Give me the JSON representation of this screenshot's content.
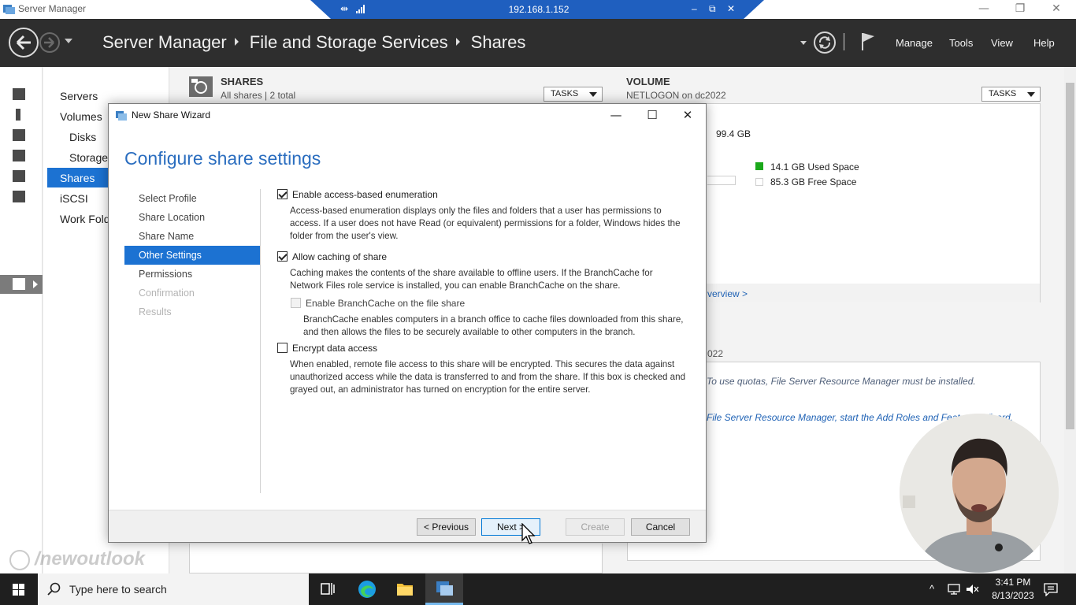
{
  "window": {
    "title": "Server Manager",
    "minimize": "—",
    "maximize": "❐",
    "close": "✕"
  },
  "rdp": {
    "address": "192.168.1.152",
    "minimize": "–",
    "restore": "⧉",
    "close": "✕"
  },
  "header": {
    "breadcrumb": [
      "Server Manager",
      "File and Storage Services",
      "Shares"
    ],
    "menu": [
      "Manage",
      "Tools",
      "View",
      "Help"
    ]
  },
  "nav": {
    "items": [
      "Servers",
      "Volumes",
      "Disks",
      "Storage",
      "Shares",
      "iSCSI",
      "Work Fold"
    ],
    "selected": "Shares"
  },
  "shares_section": {
    "title": "SHARES",
    "subtitle": "All shares | 2 total",
    "tasks": "TASKS"
  },
  "volume_section": {
    "title": "VOLUME",
    "subtitle": "NETLOGON on dc2022",
    "tasks": "TASKS",
    "capacity": "99.4 GB",
    "used": "14.1 GB Used Space",
    "free": "85.3 GB Free Space",
    "used_color": "#1aa81a",
    "overview_link": "verview >",
    "quota_header": "022",
    "quota_msg": "To use quotas, File Server Resource Manager must be installed.",
    "quota_link": "File Server Resource Manager, start the Add Roles and Features Wizard."
  },
  "dialog": {
    "title": "New Share Wizard",
    "heading": "Configure share settings",
    "steps": [
      {
        "label": "Select Profile",
        "state": "normal"
      },
      {
        "label": "Share Location",
        "state": "normal"
      },
      {
        "label": "Share Name",
        "state": "normal"
      },
      {
        "label": "Other Settings",
        "state": "active"
      },
      {
        "label": "Permissions",
        "state": "normal"
      },
      {
        "label": "Confirmation",
        "state": "disabled"
      },
      {
        "label": "Results",
        "state": "disabled"
      }
    ],
    "options": {
      "abe_label": "Enable access-based enumeration",
      "abe_desc": "Access-based enumeration displays only the files and folders that a user has permissions to access. If a user does not have Read (or equivalent) permissions for a folder, Windows hides the folder from the user's view.",
      "caching_label": "Allow caching of share",
      "caching_desc": "Caching makes the contents of the share available to offline users. If the BranchCache for Network Files role service is installed, you can enable BranchCache on the share.",
      "branchcache_label": "Enable BranchCache on the file share",
      "branchcache_desc": "BranchCache enables computers in a branch office to cache files downloaded from this share, and then allows the files to be securely available to other computers in the branch.",
      "encrypt_label": "Encrypt data access",
      "encrypt_desc": "When enabled, remote file access to this share will be encrypted. This secures the data against unauthorized access while the data is transferred to and from the share. If this box is checked and grayed out, an administrator has turned on encryption for the entire server."
    },
    "buttons": {
      "previous": "< Previous",
      "next": "Next >",
      "create": "Create",
      "cancel": "Cancel"
    }
  },
  "watermark": "/newoutlook",
  "taskbar": {
    "search_placeholder": "Type here to search",
    "time": "3:41 PM",
    "date": "8/13/2023"
  }
}
